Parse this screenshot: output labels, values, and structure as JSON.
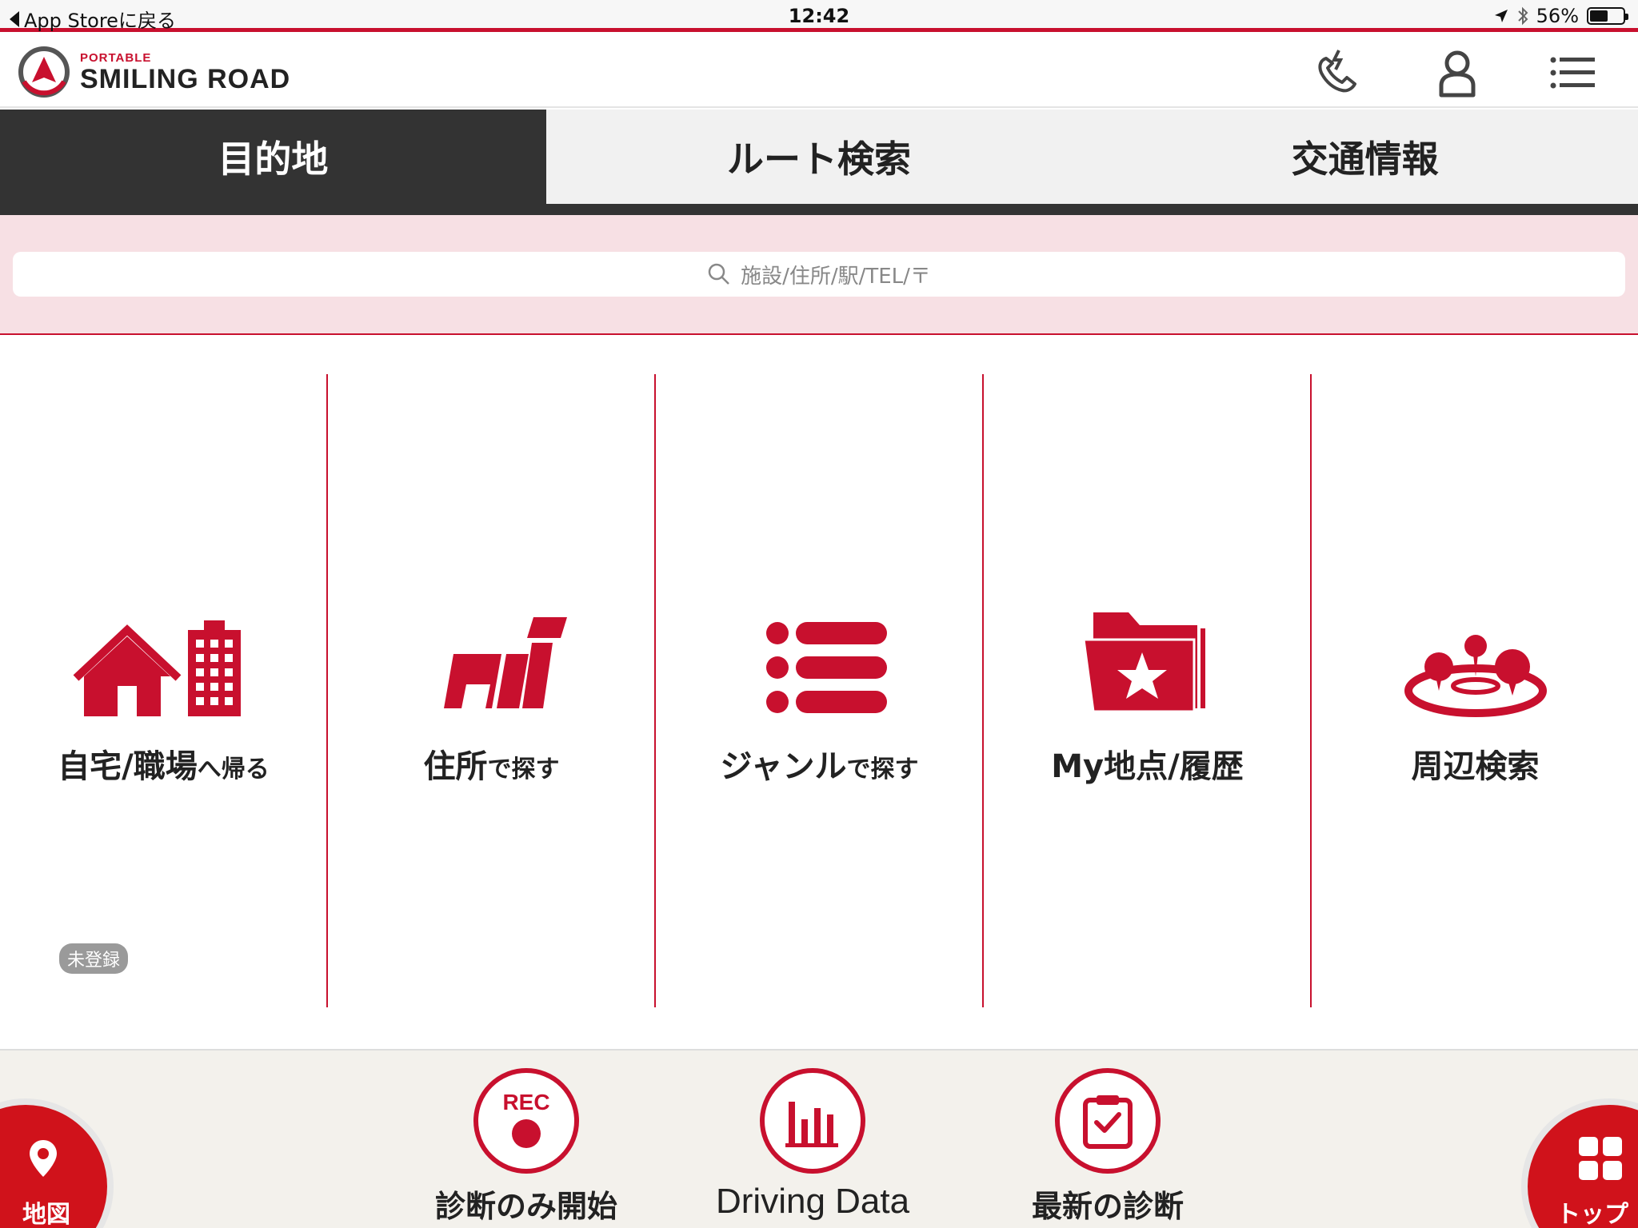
{
  "status_bar": {
    "back_label": "App Storeに戻る",
    "time": "12:42",
    "battery": "56%",
    "battery_level": 0.56
  },
  "header": {
    "logo_sub": "PORTABLE",
    "logo_main": "SMILING ROAD"
  },
  "tabs": [
    {
      "label": "目的地",
      "active": true
    },
    {
      "label": "ルート検索",
      "active": false
    },
    {
      "label": "交通情報",
      "active": false
    }
  ],
  "search": {
    "placeholder": "施設/住所/駅/TEL/〒"
  },
  "menu": {
    "home": {
      "badge": "未登録",
      "label_main": "自宅/職場",
      "label_small": "へ帰る"
    },
    "address": {
      "label_main": "住所",
      "label_small": "で探す"
    },
    "genre": {
      "label_main": "ジャンル",
      "label_small": "で探す"
    },
    "my_point": {
      "label_main": "My地点/履歴"
    },
    "nearby": {
      "label_main": "周辺検索"
    }
  },
  "bottom": {
    "rec_icon_text": "REC",
    "rec_label": "診断のみ開始",
    "driving_label": "Driving Data",
    "latest_label": "最新の診断",
    "map_label": "地図",
    "top_label": "トップ"
  },
  "colors": {
    "accent": "#c8102e",
    "tab_active": "#333333",
    "search_bg": "#f7e0e4"
  }
}
